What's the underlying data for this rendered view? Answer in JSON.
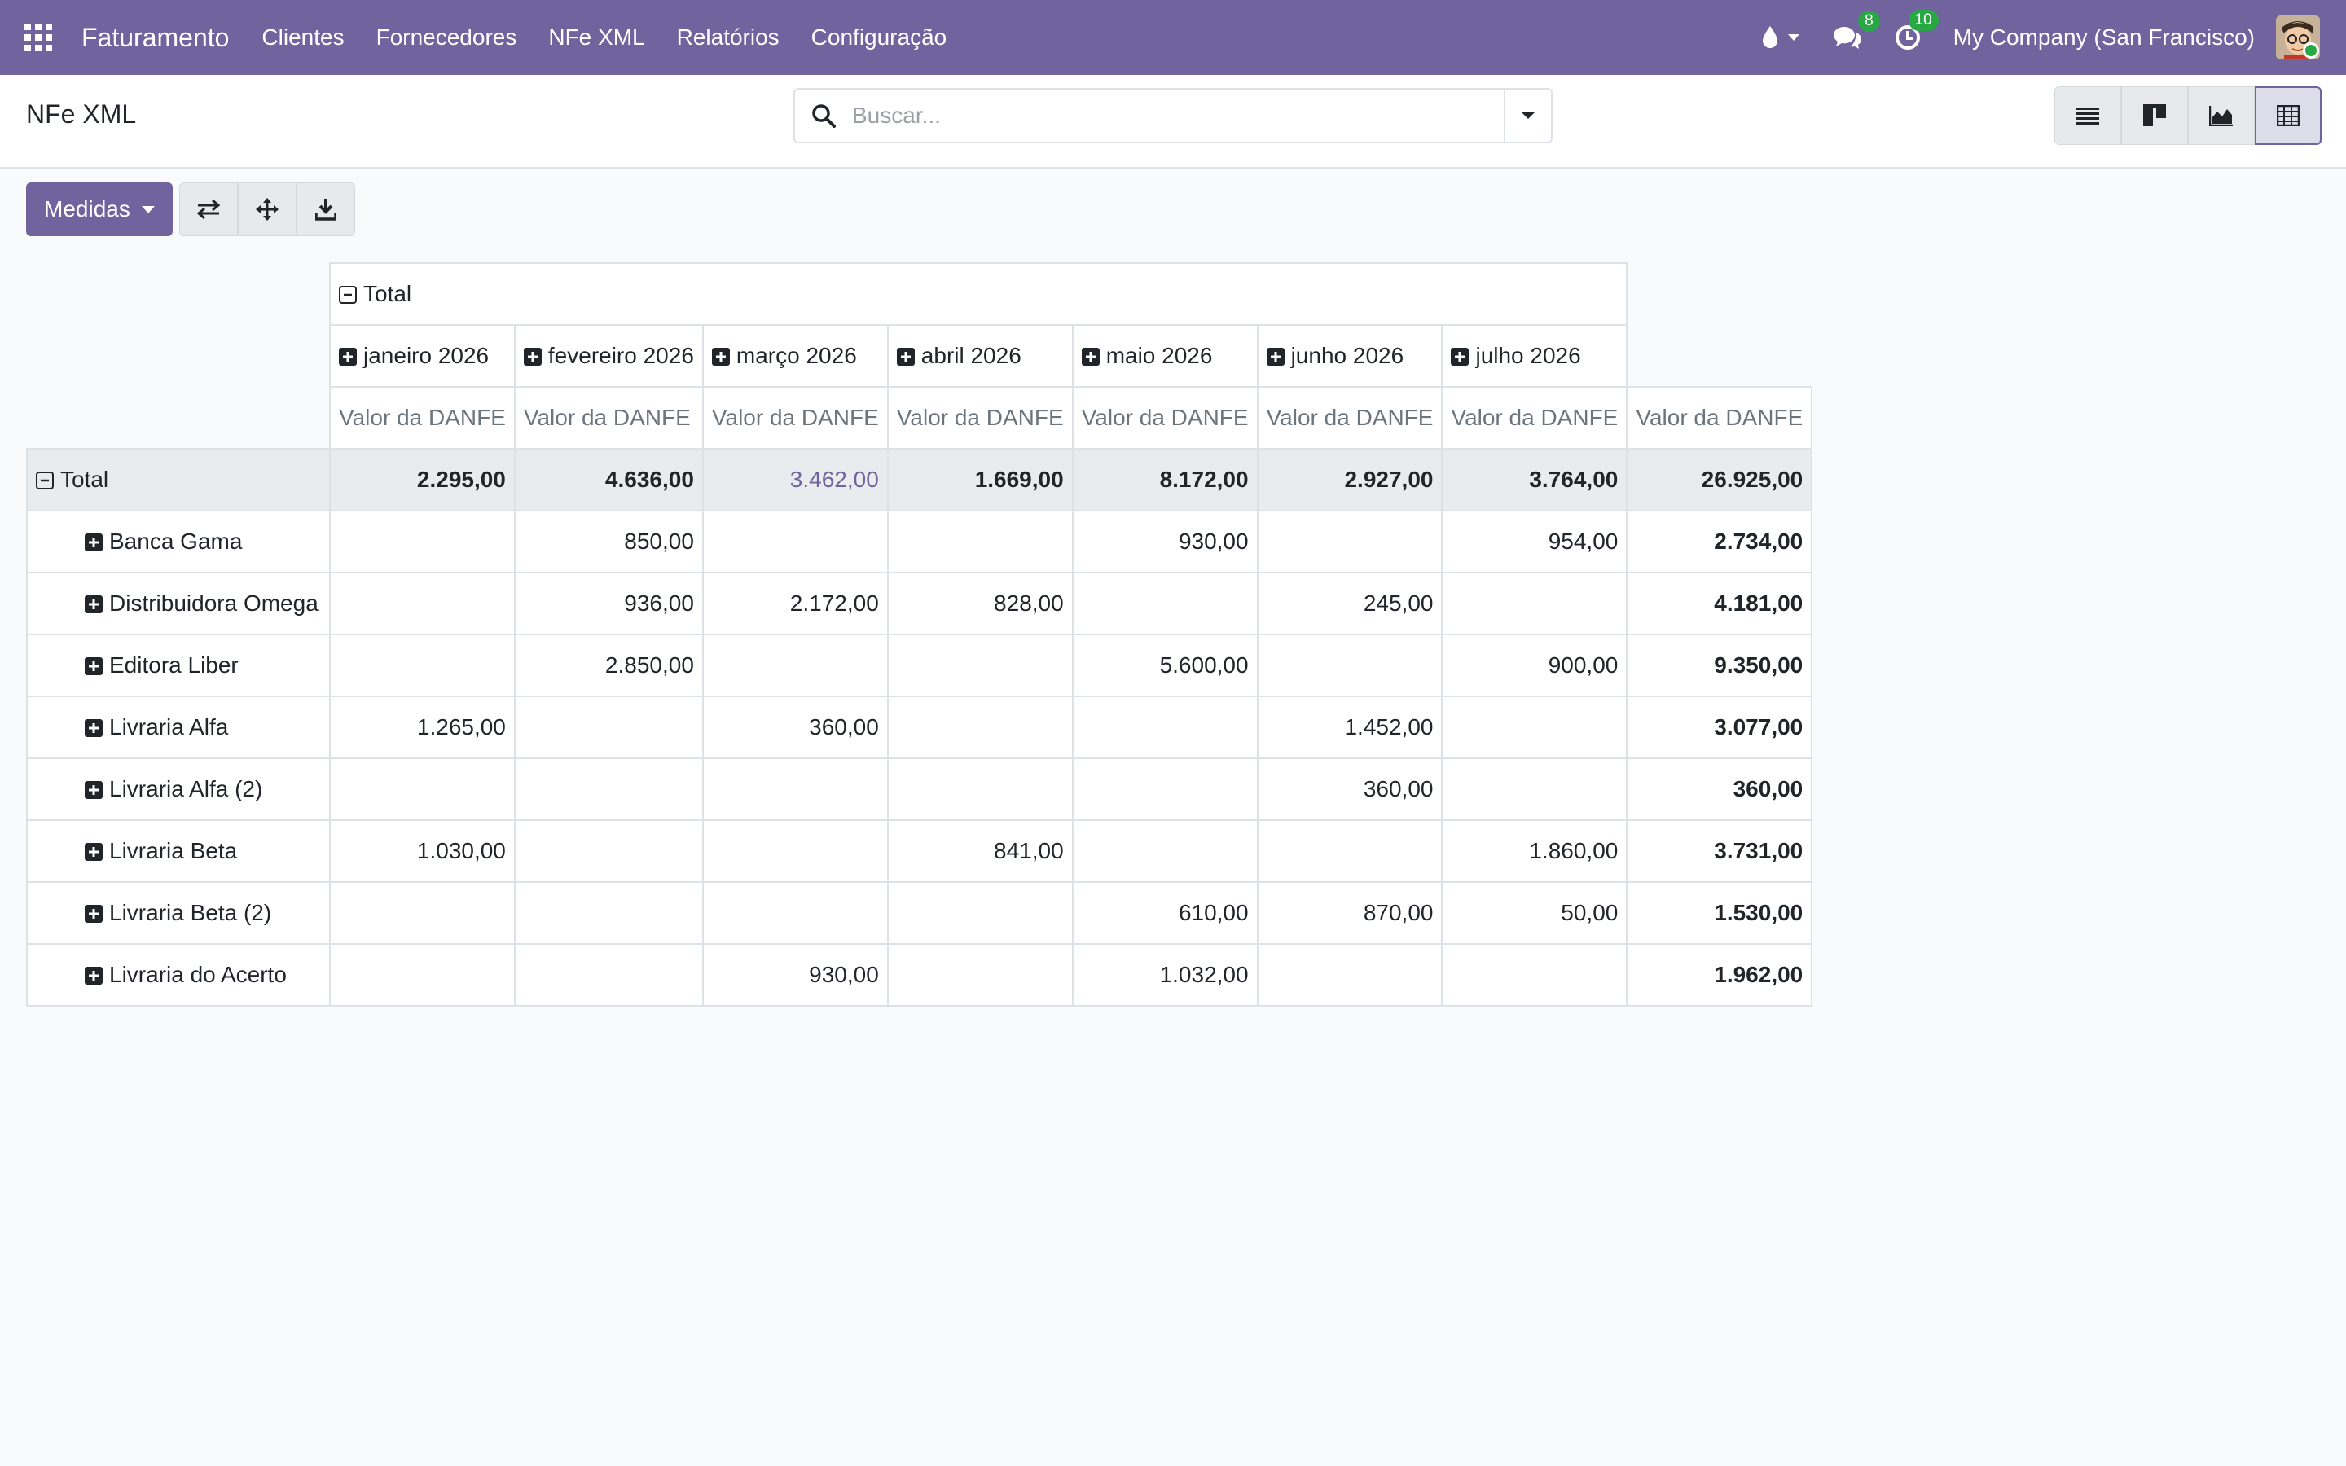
{
  "navbar": {
    "brand": "Faturamento",
    "menu": [
      "Clientes",
      "Fornecedores",
      "NFe XML",
      "Relatórios",
      "Configuração"
    ],
    "messages_count": "8",
    "activities_count": "10",
    "company": "My Company (San Francisco)"
  },
  "control_panel": {
    "title": "NFe XML",
    "search_placeholder": "Buscar..."
  },
  "toolbar": {
    "measures_label": "Medidas"
  },
  "pivot": {
    "col_total_label": "Total",
    "months": [
      "janeiro 2026",
      "fevereiro 2026",
      "março 2026",
      "abril 2026",
      "maio 2026",
      "junho 2026",
      "julho 2026"
    ],
    "measure_label": "Valor da DANFE",
    "row_total_label": "Total",
    "totals": [
      "2.295,00",
      "4.636,00",
      "3.462,00",
      "1.669,00",
      "8.172,00",
      "2.927,00",
      "3.764,00",
      "26.925,00"
    ],
    "rows": [
      {
        "label": "Banca Gama",
        "values": [
          "",
          "850,00",
          "",
          "",
          "930,00",
          "",
          "954,00"
        ],
        "total": "2.734,00"
      },
      {
        "label": "Distribuidora Omega",
        "values": [
          "",
          "936,00",
          "2.172,00",
          "828,00",
          "",
          "245,00",
          ""
        ],
        "total": "4.181,00"
      },
      {
        "label": "Editora Liber",
        "values": [
          "",
          "2.850,00",
          "",
          "",
          "5.600,00",
          "",
          "900,00"
        ],
        "total": "9.350,00"
      },
      {
        "label": "Livraria Alfa",
        "values": [
          "1.265,00",
          "",
          "360,00",
          "",
          "",
          "1.452,00",
          ""
        ],
        "total": "3.077,00"
      },
      {
        "label": "Livraria Alfa (2)",
        "values": [
          "",
          "",
          "",
          "",
          "",
          "360,00",
          ""
        ],
        "total": "360,00"
      },
      {
        "label": "Livraria Beta",
        "values": [
          "1.030,00",
          "",
          "",
          "841,00",
          "",
          "",
          "1.860,00"
        ],
        "total": "3.731,00"
      },
      {
        "label": "Livraria Beta (2)",
        "values": [
          "",
          "",
          "",
          "",
          "610,00",
          "870,00",
          "50,00"
        ],
        "total": "1.530,00"
      },
      {
        "label": "Livraria do Acerto",
        "values": [
          "",
          "",
          "930,00",
          "",
          "1.032,00",
          "",
          ""
        ],
        "total": "1.962,00"
      }
    ]
  }
}
